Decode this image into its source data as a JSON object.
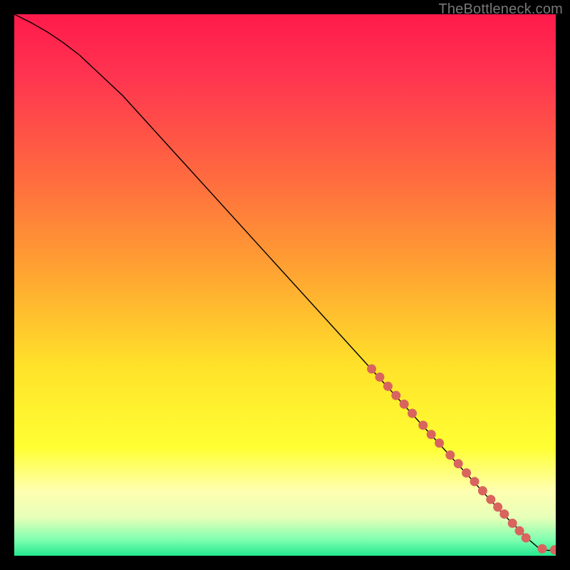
{
  "watermark": "TheBottleneck.com",
  "chart_data": {
    "type": "line",
    "title": "",
    "xlabel": "",
    "ylabel": "",
    "xlim": [
      0,
      100
    ],
    "ylim": [
      0,
      100
    ],
    "grid": false,
    "background_gradient_stops": [
      {
        "pct": 0,
        "color": "#ff1a4b"
      },
      {
        "pct": 12,
        "color": "#ff3650"
      },
      {
        "pct": 30,
        "color": "#ff6a3f"
      },
      {
        "pct": 48,
        "color": "#ffa531"
      },
      {
        "pct": 65,
        "color": "#ffe22a"
      },
      {
        "pct": 80,
        "color": "#ffff33"
      },
      {
        "pct": 88,
        "color": "#ffffb0"
      },
      {
        "pct": 93,
        "color": "#e6ffb8"
      },
      {
        "pct": 97,
        "color": "#80ffb0"
      },
      {
        "pct": 100,
        "color": "#23e890"
      }
    ],
    "series": [
      {
        "name": "curve",
        "color": "#000000",
        "stroke_width": 1.4,
        "x": [
          0,
          3,
          6,
          9,
          12,
          20,
          40,
          60,
          80,
          90,
          93,
          95,
          97,
          98.5,
          100
        ],
        "y": [
          100,
          98.5,
          96.8,
          94.8,
          92.5,
          85.0,
          63.0,
          41.0,
          19.0,
          8.0,
          5.0,
          3.0,
          1.3,
          1.0,
          1.0
        ]
      }
    ],
    "markers": {
      "name": "highlight-points",
      "color": "#d9645e",
      "radius": 6.5,
      "x": [
        66,
        67.5,
        69,
        70.5,
        72,
        73.5,
        75.5,
        77,
        78.5,
        80.5,
        82,
        83.5,
        85,
        86.5,
        88,
        89.3,
        90.5,
        92,
        93.3,
        94.5,
        97.5,
        99.8
      ],
      "y": [
        34.5,
        33.0,
        31.3,
        29.6,
        28.0,
        26.3,
        24.1,
        22.4,
        20.8,
        18.6,
        17.0,
        15.3,
        13.7,
        12.0,
        10.4,
        9.0,
        7.7,
        6.0,
        4.6,
        3.3,
        1.3,
        1.1
      ]
    }
  }
}
